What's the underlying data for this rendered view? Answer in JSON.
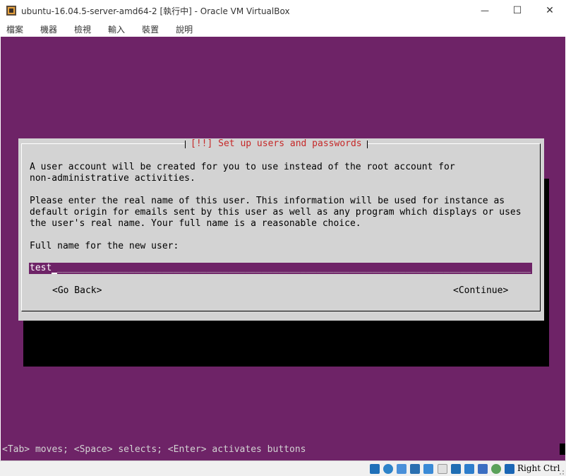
{
  "window": {
    "title": "ubuntu-16.04.5-server-amd64-2 [執行中] - Oracle VM VirtualBox",
    "minimize_glyph": "—",
    "maximize_glyph": "☐",
    "close_glyph": "✕"
  },
  "menu": {
    "items": [
      {
        "label": "檔案"
      },
      {
        "label": "機器"
      },
      {
        "label": "檢視"
      },
      {
        "label": "輸入"
      },
      {
        "label": "裝置"
      },
      {
        "label": "說明"
      }
    ]
  },
  "dialog": {
    "title": "[!!] Set up users and passwords",
    "para1_line1": "A user account will be created for you to use instead of the root account for",
    "para1_line2": "non-administrative activities.",
    "para2_line1": "Please enter the real name of this user. This information will be used for instance as",
    "para2_line2": "default origin for emails sent by this user as well as any program which displays or uses",
    "para2_line3": "the user's real name. Your full name is a reasonable choice.",
    "field_label": "Full name for the new user:",
    "field_value": "test",
    "field_fill": "____________________________________________________________________________________________________________________",
    "go_back": "<Go Back>",
    "continue": "<Continue>"
  },
  "console": {
    "hint": "<Tab> moves; <Space> selects; <Enter> activates buttons",
    "background": "#6e2367",
    "dialog_bg": "#d3d3d3",
    "title_color": "#c62828"
  },
  "statusbar": {
    "host_key": "Right Ctrl",
    "icons": [
      "hard-disk-icon",
      "optical-drive-icon",
      "audio-icon",
      "network-icon",
      "usb-icon",
      "shared-folders-icon",
      "display-icon",
      "recording-icon",
      "vt-x-icon",
      "mouse-integration-icon",
      "keyboard-capture-icon"
    ]
  }
}
